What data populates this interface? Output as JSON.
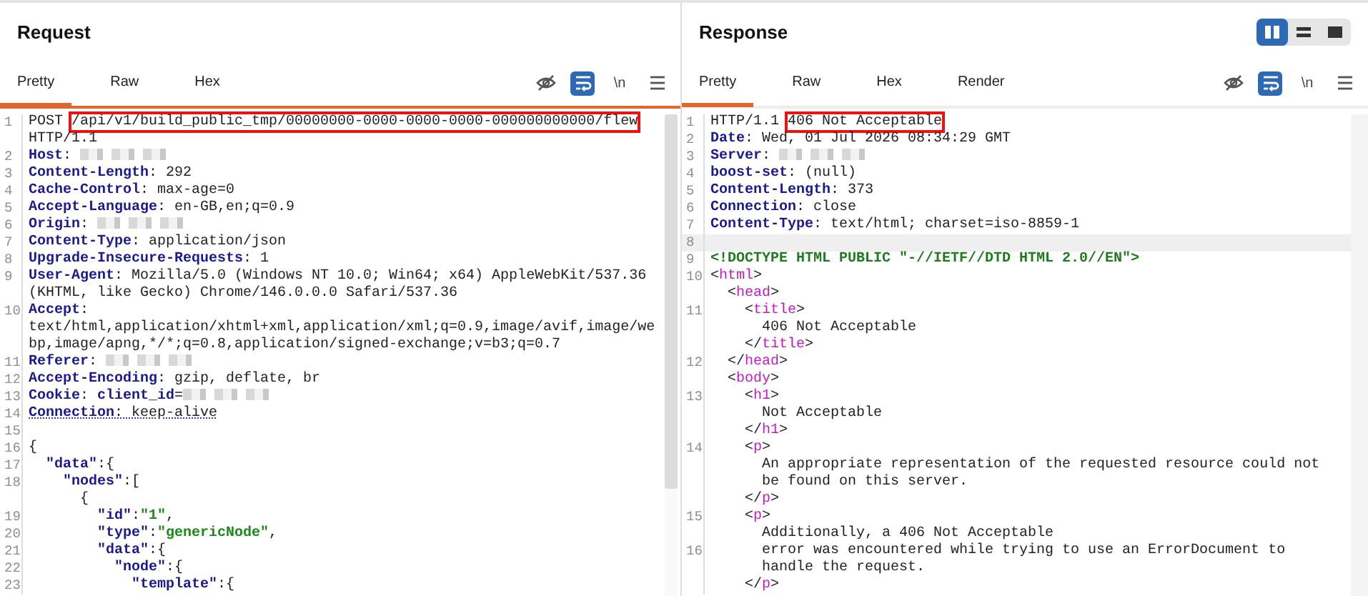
{
  "panes": [
    {
      "title": "Request",
      "focused": true,
      "tabs": [
        {
          "label": "Pretty",
          "selected": true
        },
        {
          "label": "Raw",
          "selected": false
        },
        {
          "label": "Hex",
          "selected": false
        }
      ],
      "tools": [
        {
          "kind": "hide",
          "selected": false
        },
        {
          "kind": "wrap",
          "selected": true
        },
        {
          "kind": "newline",
          "label": "\\n",
          "selected": false
        },
        {
          "kind": "menu",
          "selected": false
        }
      ],
      "lines": [
        {
          "number": "1",
          "segments": [
            {
              "kind": "plain",
              "text": "POST "
            },
            {
              "kind": "plain",
              "text": "/api/v1/build_public_tmp/00000000-0000-0000-0000-000000000000/flew",
              "highlight": true
            }
          ]
        },
        {
          "segments": [
            {
              "kind": "plain",
              "text": "HTTP/1.1"
            }
          ]
        },
        {
          "number": "2",
          "segments": [
            {
              "kind": "key",
              "text": "Host"
            },
            {
              "kind": "plain",
              "text": ": "
            },
            {
              "kind": "redacted"
            }
          ]
        },
        {
          "number": "3",
          "segments": [
            {
              "kind": "key",
              "text": "Content-Length"
            },
            {
              "kind": "plain",
              "text": ": 292"
            }
          ]
        },
        {
          "number": "4",
          "segments": [
            {
              "kind": "key",
              "text": "Cache-Control"
            },
            {
              "kind": "plain",
              "text": ": max-age=0"
            }
          ]
        },
        {
          "number": "5",
          "segments": [
            {
              "kind": "key",
              "text": "Accept-Language"
            },
            {
              "kind": "plain",
              "text": ": en-GB,en;q=0.9"
            }
          ]
        },
        {
          "number": "6",
          "segments": [
            {
              "kind": "key",
              "text": "Origin"
            },
            {
              "kind": "plain",
              "text": ": "
            },
            {
              "kind": "redacted"
            }
          ]
        },
        {
          "number": "7",
          "segments": [
            {
              "kind": "key",
              "text": "Content-Type"
            },
            {
              "kind": "plain",
              "text": ": application/json"
            }
          ]
        },
        {
          "number": "8",
          "segments": [
            {
              "kind": "key",
              "text": "Upgrade-Insecure-Requests"
            },
            {
              "kind": "plain",
              "text": ": 1"
            }
          ]
        },
        {
          "number": "9",
          "segments": [
            {
              "kind": "key",
              "text": "User-Agent"
            },
            {
              "kind": "plain",
              "text": ": Mozilla/5.0 (Windows NT 10.0; Win64; x64) AppleWebKit/537.36"
            }
          ]
        },
        {
          "segments": [
            {
              "kind": "plain",
              "text": "(KHTML, like Gecko) Chrome/146.0.0.0 Safari/537.36"
            }
          ]
        },
        {
          "number": "10",
          "segments": [
            {
              "kind": "key",
              "text": "Accept"
            },
            {
              "kind": "plain",
              "text": ":"
            }
          ]
        },
        {
          "segments": [
            {
              "kind": "plain",
              "text": "text/html,application/xhtml+xml,application/xml;q=0.9,image/avif,image/we"
            }
          ]
        },
        {
          "segments": [
            {
              "kind": "plain",
              "text": "bp,image/apng,*/*;q=0.8,application/signed-exchange;v=b3;q=0.7"
            }
          ]
        },
        {
          "number": "11",
          "segments": [
            {
              "kind": "key",
              "text": "Referer"
            },
            {
              "kind": "plain",
              "text": ": "
            },
            {
              "kind": "redacted"
            }
          ]
        },
        {
          "number": "12",
          "segments": [
            {
              "kind": "key",
              "text": "Accept-Encoding"
            },
            {
              "kind": "plain",
              "text": ": gzip, deflate, br"
            }
          ]
        },
        {
          "number": "13",
          "segments": [
            {
              "kind": "key",
              "text": "Cookie"
            },
            {
              "kind": "plain",
              "text": ": "
            },
            {
              "kind": "key",
              "text": "client_id"
            },
            {
              "kind": "plain",
              "text": "="
            },
            {
              "kind": "redacted"
            }
          ]
        },
        {
          "number": "14",
          "underlined": true,
          "segments": [
            {
              "kind": "key",
              "text": "Connection"
            },
            {
              "kind": "plain",
              "text": ": keep-alive"
            }
          ]
        },
        {
          "number": "15"
        },
        {
          "number": "16",
          "segments": [
            {
              "kind": "plain",
              "text": "{"
            }
          ]
        },
        {
          "number": "17",
          "segments": [
            {
              "kind": "key",
              "text": "  \"data\""
            },
            {
              "kind": "plain",
              "text": ":{"
            }
          ]
        },
        {
          "number": "18",
          "segments": [
            {
              "kind": "key",
              "text": "    \"nodes\""
            },
            {
              "kind": "plain",
              "text": ":["
            }
          ]
        },
        {
          "segments": [
            {
              "kind": "plain",
              "text": "      {"
            }
          ]
        },
        {
          "number": "19",
          "segments": [
            {
              "kind": "key",
              "text": "        \"id\""
            },
            {
              "kind": "plain",
              "text": ":"
            },
            {
              "kind": "string",
              "text": "\"1\""
            },
            {
              "kind": "plain",
              "text": ","
            }
          ]
        },
        {
          "number": "20",
          "segments": [
            {
              "kind": "key",
              "text": "        \"type\""
            },
            {
              "kind": "plain",
              "text": ":"
            },
            {
              "kind": "string",
              "text": "\"genericNode\""
            },
            {
              "kind": "plain",
              "text": ","
            }
          ]
        },
        {
          "number": "21",
          "segments": [
            {
              "kind": "key",
              "text": "        \"data\""
            },
            {
              "kind": "plain",
              "text": ":{"
            }
          ]
        },
        {
          "number": "22",
          "segments": [
            {
              "kind": "key",
              "text": "          \"node\""
            },
            {
              "kind": "plain",
              "text": ":{"
            }
          ]
        },
        {
          "number": "23",
          "segments": [
            {
              "kind": "key",
              "text": "            \"template\""
            },
            {
              "kind": "plain",
              "text": ":{"
            }
          ]
        }
      ]
    },
    {
      "title": "Response",
      "focused": false,
      "layouts": [
        {
          "kind": "columns",
          "selected": true
        },
        {
          "kind": "rows",
          "selected": false
        },
        {
          "kind": "single",
          "selected": false
        }
      ],
      "tabs": [
        {
          "label": "Pretty",
          "selected": true
        },
        {
          "label": "Raw",
          "selected": false
        },
        {
          "label": "Hex",
          "selected": false
        },
        {
          "label": "Render",
          "selected": false
        }
      ],
      "tools": [
        {
          "kind": "hide",
          "selected": false
        },
        {
          "kind": "wrap",
          "selected": true
        },
        {
          "kind": "newline",
          "label": "\\n",
          "selected": false
        },
        {
          "kind": "menu",
          "selected": false
        }
      ],
      "lines": [
        {
          "number": "1",
          "segments": [
            {
              "kind": "plain",
              "text": "HTTP/1.1 "
            },
            {
              "kind": "plain",
              "text": "406 Not Acceptable",
              "highlight": true
            }
          ]
        },
        {
          "number": "2",
          "segments": [
            {
              "kind": "key",
              "text": "Date"
            },
            {
              "kind": "plain",
              "text": ": Wed, 01 Jul 2026 08:34:29 GMT"
            }
          ]
        },
        {
          "number": "3",
          "segments": [
            {
              "kind": "key",
              "text": "Server"
            },
            {
              "kind": "plain",
              "text": ": "
            },
            {
              "kind": "redacted"
            }
          ]
        },
        {
          "number": "4",
          "segments": [
            {
              "kind": "key",
              "text": "boost-set"
            },
            {
              "kind": "plain",
              "text": ": (null)"
            }
          ]
        },
        {
          "number": "5",
          "segments": [
            {
              "kind": "key",
              "text": "Content-Length"
            },
            {
              "kind": "plain",
              "text": ": 373"
            }
          ]
        },
        {
          "number": "6",
          "segments": [
            {
              "kind": "key",
              "text": "Connection"
            },
            {
              "kind": "plain",
              "text": ": close"
            }
          ]
        },
        {
          "number": "7",
          "segments": [
            {
              "kind": "key",
              "text": "Content-Type"
            },
            {
              "kind": "plain",
              "text": ": text/html; charset=iso-8859-1"
            }
          ]
        },
        {
          "number": "8",
          "current": true
        },
        {
          "number": "9",
          "segments": [
            {
              "kind": "doctype",
              "text": "<!DOCTYPE HTML PUBLIC \"-//IETF//DTD HTML 2.0//EN\">"
            }
          ]
        },
        {
          "number": "10",
          "segments": [
            {
              "kind": "plain",
              "text": "<"
            },
            {
              "kind": "tag",
              "text": "html"
            },
            {
              "kind": "plain",
              "text": ">"
            }
          ]
        },
        {
          "segments": [
            {
              "kind": "plain",
              "text": "  <"
            },
            {
              "kind": "tag",
              "text": "head"
            },
            {
              "kind": "plain",
              "text": ">"
            }
          ]
        },
        {
          "number": "11",
          "segments": [
            {
              "kind": "plain",
              "text": "    <"
            },
            {
              "kind": "tag",
              "text": "title"
            },
            {
              "kind": "plain",
              "text": ">"
            }
          ]
        },
        {
          "segments": [
            {
              "kind": "plain",
              "text": "      406 Not Acceptable"
            }
          ]
        },
        {
          "segments": [
            {
              "kind": "plain",
              "text": "    </"
            },
            {
              "kind": "tag",
              "text": "title"
            },
            {
              "kind": "plain",
              "text": ">"
            }
          ]
        },
        {
          "number": "12",
          "segments": [
            {
              "kind": "plain",
              "text": "  </"
            },
            {
              "kind": "tag",
              "text": "head"
            },
            {
              "kind": "plain",
              "text": ">"
            }
          ]
        },
        {
          "segments": [
            {
              "kind": "plain",
              "text": "  <"
            },
            {
              "kind": "tag",
              "text": "body"
            },
            {
              "kind": "plain",
              "text": ">"
            }
          ]
        },
        {
          "number": "13",
          "segments": [
            {
              "kind": "plain",
              "text": "    <"
            },
            {
              "kind": "tag",
              "text": "h1"
            },
            {
              "kind": "plain",
              "text": ">"
            }
          ]
        },
        {
          "segments": [
            {
              "kind": "plain",
              "text": "      Not Acceptable"
            }
          ]
        },
        {
          "segments": [
            {
              "kind": "plain",
              "text": "    </"
            },
            {
              "kind": "tag",
              "text": "h1"
            },
            {
              "kind": "plain",
              "text": ">"
            }
          ]
        },
        {
          "number": "14",
          "segments": [
            {
              "kind": "plain",
              "text": "    <"
            },
            {
              "kind": "tag",
              "text": "p"
            },
            {
              "kind": "plain",
              "text": ">"
            }
          ]
        },
        {
          "segments": [
            {
              "kind": "plain",
              "text": "      An appropriate representation of the requested resource could not"
            }
          ]
        },
        {
          "segments": [
            {
              "kind": "plain",
              "text": "      be found on this server."
            }
          ]
        },
        {
          "segments": [
            {
              "kind": "plain",
              "text": "    </"
            },
            {
              "kind": "tag",
              "text": "p"
            },
            {
              "kind": "plain",
              "text": ">"
            }
          ]
        },
        {
          "number": "15",
          "segments": [
            {
              "kind": "plain",
              "text": "    <"
            },
            {
              "kind": "tag",
              "text": "p"
            },
            {
              "kind": "plain",
              "text": ">"
            }
          ]
        },
        {
          "segments": [
            {
              "kind": "plain",
              "text": "      Additionally, a 406 Not Acceptable"
            }
          ]
        },
        {
          "number": "16",
          "segments": [
            {
              "kind": "plain",
              "text": "      error was encountered while trying to use an ErrorDocument to"
            }
          ]
        },
        {
          "segments": [
            {
              "kind": "plain",
              "text": "      handle the request."
            }
          ]
        },
        {
          "segments": [
            {
              "kind": "plain",
              "text": "    </"
            },
            {
              "kind": "tag",
              "text": "p"
            },
            {
              "kind": "plain",
              "text": ">"
            }
          ]
        }
      ]
    }
  ]
}
